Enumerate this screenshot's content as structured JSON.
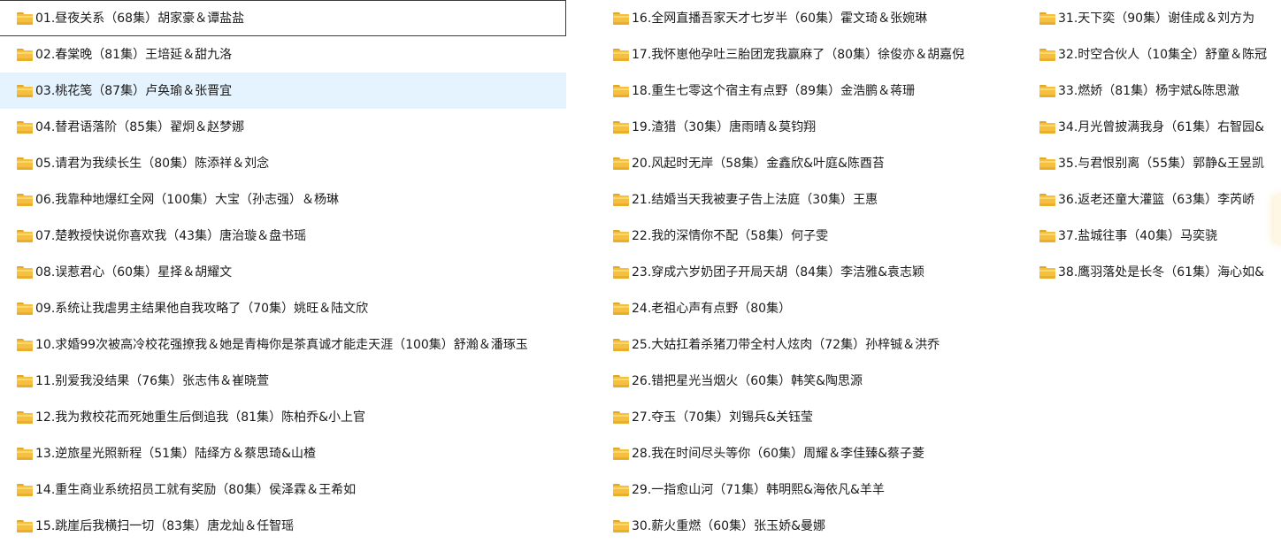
{
  "colors": {
    "hover_bg": "#e5f3ff",
    "focus_border": "#3c3c3c",
    "folder": "#f5c042"
  },
  "icons": {
    "item_icon": "folder-icon"
  },
  "columns": [
    {
      "items": [
        {
          "name": "01.昼夜关系（68集）胡家豪＆谭盐盐"
        },
        {
          "name": "02.春棠晚（81集）王培延＆甜九洛"
        },
        {
          "name": "03.桃花笺（87集）卢奂瑜＆张晋宜"
        },
        {
          "name": "04.替君语落阶（85集）翟炯＆赵梦娜"
        },
        {
          "name": "05.请君为我续长生（80集）陈添祥＆刘念"
        },
        {
          "name": "06.我靠种地爆红全网（100集）大宝（孙志强）＆杨琳"
        },
        {
          "name": "07.楚教授快说你喜欢我（43集）唐治璇＆盘书瑶"
        },
        {
          "name": "08.误惹君心（60集）星择＆胡耀文"
        },
        {
          "name": "09.系统让我虐男主结果他自我攻略了（70集）姚旺＆陆文欣"
        },
        {
          "name": "10.求婚99次被高冷校花强撩我＆她是青梅你是茶真诚才能走天涯（100集）舒瀚＆潘琢玉"
        },
        {
          "name": "11.别爱我没结果（76集）张志伟＆崔晓萱"
        },
        {
          "name": "12.我为救校花而死她重生后倒追我（81集）陈柏乔&小上官"
        },
        {
          "name": "13.逆旅星光照新程（51集）陆绎方＆蔡思琦&山楂"
        },
        {
          "name": "14.重生商业系统招员工就有奖励（80集）侯泽霖＆王希如"
        },
        {
          "name": "15.跳崖后我横扫一切（83集）唐龙灿＆任智瑶"
        }
      ]
    },
    {
      "items": [
        {
          "name": "16.全网直播吾家天才七岁半（60集）霍文琦＆张婉琳"
        },
        {
          "name": "17.我怀崽他孕吐三胎团宠我赢麻了（80集）徐俊亦＆胡嘉倪"
        },
        {
          "name": "18.重生七零这个宿主有点野（89集）金浩鹏＆蒋珊"
        },
        {
          "name": "19.渣猎（30集）唐雨晴＆莫钧翔"
        },
        {
          "name": "20.风起时无岸（58集）金鑫欣&叶庭&陈酉苔"
        },
        {
          "name": "21.结婚当天我被妻子告上法庭（30集）王惠"
        },
        {
          "name": "22.我的深情你不配（58集）何子雯"
        },
        {
          "name": "23.穿成六岁奶团子开局天胡（84集）李洁雅&袁志颖"
        },
        {
          "name": "24.老祖心声有点野（80集）"
        },
        {
          "name": "25.大姑扛着杀猪刀带全村人炫肉（72集）孙梓铖＆洪乔"
        },
        {
          "name": "26.错把星光当烟火（60集）韩笑&陶思源"
        },
        {
          "name": "27.夺玉（70集）刘锡兵&关钰莹"
        },
        {
          "name": "28.我在时间尽头等你（60集）周耀＆李佳臻&蔡子菱"
        },
        {
          "name": "29.一指愈山河（71集）韩明熙&海依凡&羊羊"
        },
        {
          "name": "30.薪火重燃（60集）张玉娇&曼娜"
        }
      ]
    },
    {
      "items": [
        {
          "name": "31.天下奕（90集）谢佳成＆刘方为"
        },
        {
          "name": "32.时空合伙人（10集全）舒童＆陈冠"
        },
        {
          "name": "33.燃娇（81集）杨宇斌&陈思澈"
        },
        {
          "name": "34.月光曾披满我身（61集）右智园&"
        },
        {
          "name": "35.与君恨别离（55集）郭静&王昱凯"
        },
        {
          "name": "36.返老还童大灌篮（63集）李芮峤"
        },
        {
          "name": "37.盐城往事（40集）马奕骁"
        },
        {
          "name": "38.鹰羽落处是长冬（61集）海心如&"
        }
      ]
    }
  ]
}
